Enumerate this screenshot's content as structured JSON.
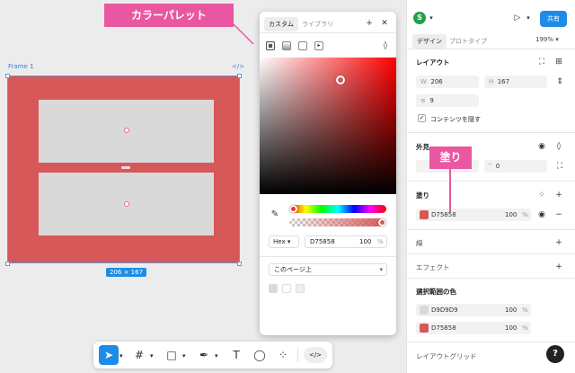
{
  "canvas": {
    "frame_name": "Frame 1",
    "code_icon": "code-icon",
    "frame_color": "#d75858",
    "block_color": "#d9d9d9",
    "size_label": "206 × 167"
  },
  "callouts": {
    "color_palette": "カラーパレット",
    "fill": "塗り"
  },
  "picker": {
    "tabs": [
      "カスタム",
      "ライブラリ"
    ],
    "add_icon": "plus-icon",
    "close_icon": "close-icon",
    "mode_icons": [
      "solid-fill-icon",
      "gradient-icon",
      "image-fill-icon",
      "video-fill-icon"
    ],
    "drop_icon": "blend-drop-icon",
    "eyedropper_icon": "eyedropper-icon",
    "format": "Hex",
    "hex": "D75858",
    "opacity": "100",
    "percent": "%",
    "scope": "このページ上",
    "swatches": [
      "#d9d9d9",
      "#ffffff",
      "#eeeeee"
    ]
  },
  "panel": {
    "avatar_letter": "S",
    "share_label": "共有",
    "tabs": [
      "デザイン",
      "プロトタイプ"
    ],
    "zoom": "199%",
    "layout": {
      "title": "レイアウト",
      "w_label": "W",
      "w_value": "206",
      "h_label": "H",
      "h_value": "167",
      "gap_value": "9",
      "clip_label": "コンテンツを隠す"
    },
    "appearance": {
      "title": "外見",
      "radius_value": "0"
    },
    "fill": {
      "title": "塗り",
      "hex": "D75858",
      "opacity": "100",
      "percent": "%",
      "color": "#d75858"
    },
    "stroke_title": "線",
    "effects_title": "エフェクト",
    "selection_colors": {
      "title": "選択範囲の色",
      "items": [
        {
          "hex": "D9D9D9",
          "opacity": "100",
          "percent": "%",
          "color": "#d9d9d9"
        },
        {
          "hex": "D75858",
          "opacity": "100",
          "percent": "%",
          "color": "#d75858"
        }
      ]
    },
    "layout_grid_title": "レイアウトグリッド",
    "help_label": "?"
  },
  "toolbar": {
    "tools": [
      "move-tool-icon",
      "frame-tool-icon",
      "shape-tool-icon",
      "pen-tool-icon",
      "text-tool-icon",
      "comment-tool-icon",
      "actions-tool-icon",
      "dev-mode-icon"
    ],
    "text_glyph": "T"
  }
}
